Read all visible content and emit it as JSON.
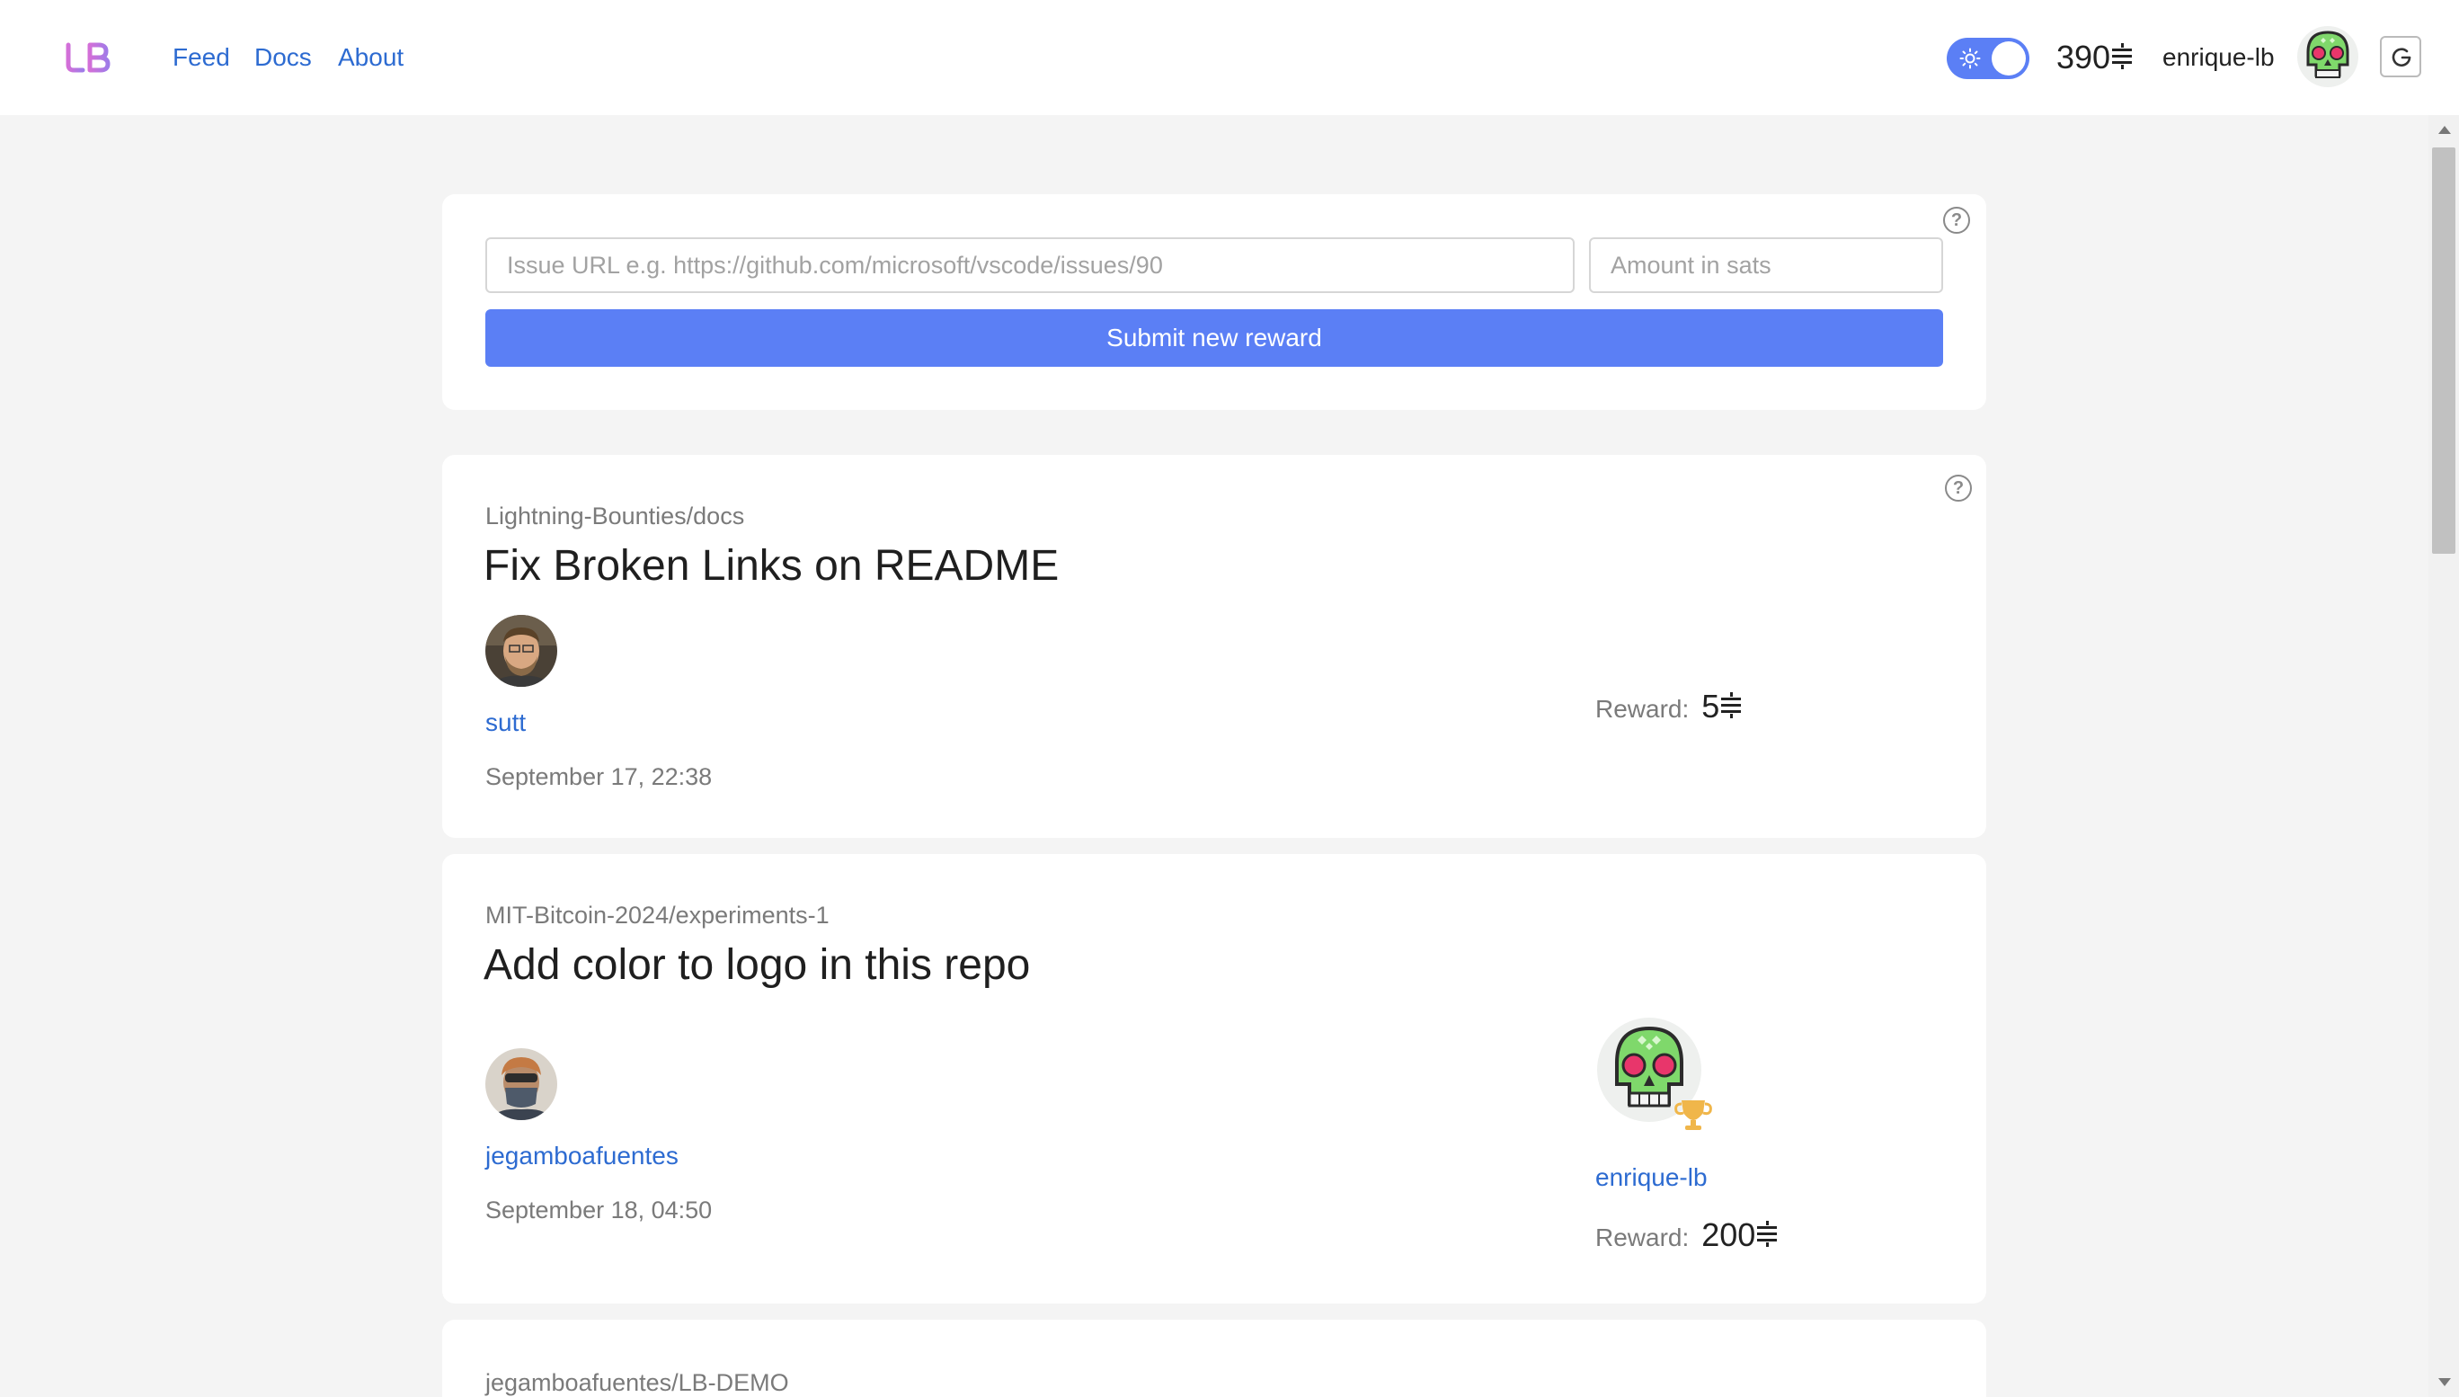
{
  "header": {
    "logo_text": "LB",
    "nav": [
      "Feed",
      "Docs",
      "About"
    ],
    "balance": "390",
    "username": "enrique-lb",
    "accent_color": "#5b7ff5",
    "link_color": "#2d6bd1"
  },
  "submit_form": {
    "issue_placeholder": "Issue URL e.g. https://github.com/microsoft/vscode/issues/90",
    "amount_placeholder": "Amount in sats",
    "submit_label": "Submit new reward",
    "help": "?"
  },
  "rewards": [
    {
      "repo": "Lightning-Bounties/docs",
      "title": "Fix Broken Links on README",
      "author": "sutt",
      "date": "September 17, 22:38",
      "reward_label": "Reward:",
      "reward_value": "5",
      "help": "?"
    },
    {
      "repo": "MIT-Bitcoin-2024/experiments-1",
      "title": "Add color to logo in this repo",
      "author": "jegamboafuentes",
      "date": "September 18, 04:50",
      "winner": "enrique-lb",
      "reward_label": "Reward:",
      "reward_value": "200"
    },
    {
      "repo": "jegamboafuentes/LB-DEMO"
    }
  ]
}
